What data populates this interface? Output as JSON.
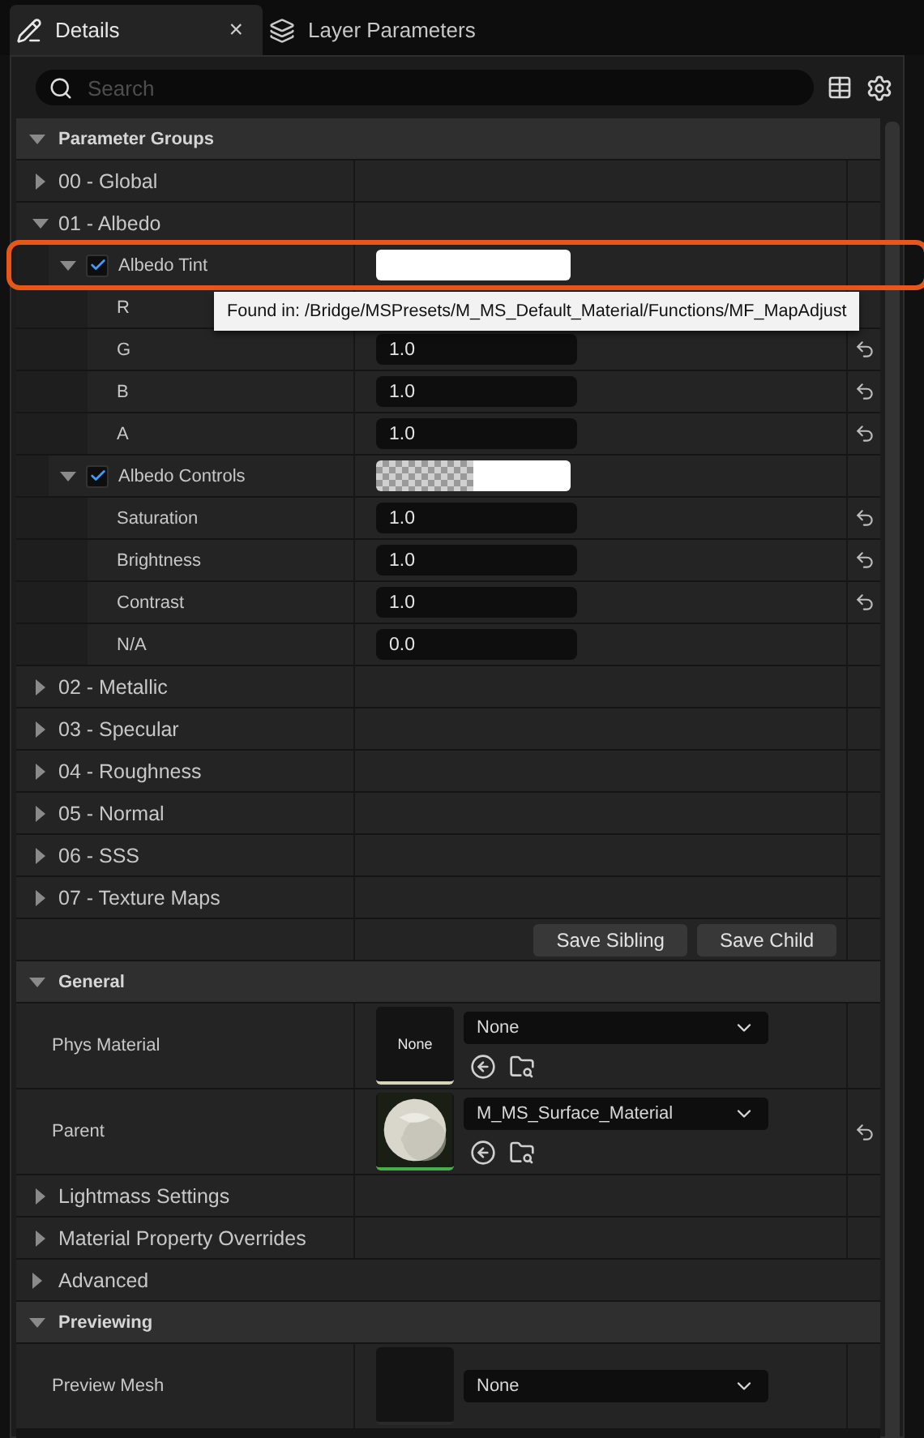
{
  "tabs": [
    {
      "label": "Details",
      "selected": true,
      "close": "×"
    },
    {
      "label": "Layer Parameters",
      "selected": false
    }
  ],
  "search": {
    "placeholder": "Search"
  },
  "sections": [
    {
      "title": "Parameter Groups",
      "expanded": true,
      "rows": [
        {
          "kind": "group",
          "label": "00 - Global",
          "expanded": false
        },
        {
          "kind": "group",
          "label": "01 - Albedo",
          "expanded": true,
          "children": [
            {
              "kind": "param",
              "label": "Albedo Tint",
              "expanded": true,
              "checked": true,
              "swatch": {
                "kind": "opaque"
              },
              "highlighted": true,
              "tooltip": "Found in: /Bridge/MSPresets/M_MS_Default_Material/Functions/MF_MapAdjust",
              "children": [
                {
                  "kind": "value",
                  "label": "R"
                },
                {
                  "kind": "value",
                  "label": "G",
                  "value": "1.0",
                  "resettable": true
                },
                {
                  "kind": "value",
                  "label": "B",
                  "value": "1.0",
                  "resettable": true
                },
                {
                  "kind": "value",
                  "label": "A",
                  "value": "1.0",
                  "resettable": true
                }
              ]
            },
            {
              "kind": "param",
              "label": "Albedo Controls",
              "expanded": true,
              "checked": true,
              "swatch": {
                "kind": "translucent"
              },
              "highlighted": false,
              "children": [
                {
                  "kind": "value",
                  "label": "Saturation",
                  "value": "1.0",
                  "resettable": true
                },
                {
                  "kind": "value",
                  "label": "Brightness",
                  "value": "1.0",
                  "resettable": true
                },
                {
                  "kind": "value",
                  "label": "Contrast",
                  "value": "1.0",
                  "resettable": true
                },
                {
                  "kind": "value",
                  "label": "N/A",
                  "value": "0.0",
                  "resettable": false
                }
              ]
            }
          ]
        },
        {
          "kind": "group",
          "label": "02 - Metallic",
          "expanded": false
        },
        {
          "kind": "group",
          "label": "03 - Specular",
          "expanded": false
        },
        {
          "kind": "group",
          "label": "04 - Roughness",
          "expanded": false
        },
        {
          "kind": "group",
          "label": "05 - Normal",
          "expanded": false
        },
        {
          "kind": "group",
          "label": "06 - SSS",
          "expanded": false
        },
        {
          "kind": "group",
          "label": "07 - Texture Maps",
          "expanded": false
        }
      ],
      "buttons": [
        "Save Sibling",
        "Save Child"
      ]
    },
    {
      "title": "General",
      "expanded": true,
      "rows": [
        {
          "kind": "asset",
          "label": "Phys Material",
          "thumb": {
            "kind": "text",
            "label": "None"
          },
          "value": "None",
          "actions": true,
          "resettable": false
        },
        {
          "kind": "asset",
          "label": "Parent",
          "value": "M_MS_Surface_Material",
          "actions": true,
          "resettable": true
        },
        {
          "kind": "group",
          "label": "Lightmass Settings",
          "expanded": false
        },
        {
          "kind": "group",
          "label": "Material Property Overrides",
          "expanded": false
        },
        {
          "kind": "advanced",
          "label": "Advanced",
          "expanded": false
        }
      ]
    },
    {
      "title": "Previewing",
      "expanded": true,
      "rows": [
        {
          "kind": "asset",
          "label": "Preview Mesh",
          "thumb": {
            "kind": "blank"
          },
          "value": "None",
          "actions": false,
          "resettable": false
        }
      ]
    }
  ]
}
